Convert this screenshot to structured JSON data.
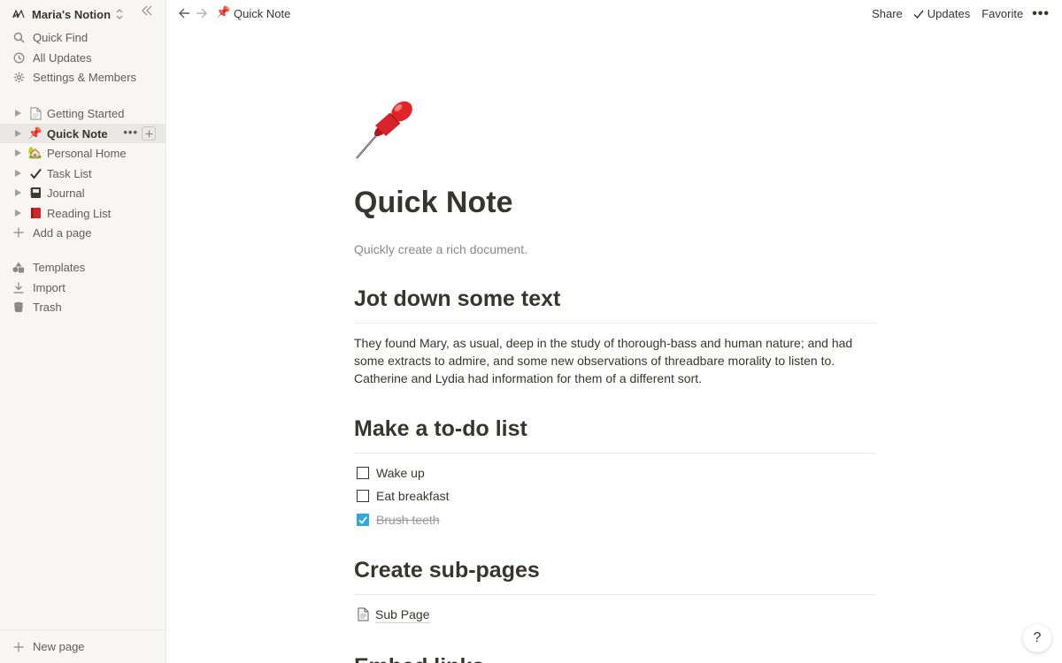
{
  "workspace": {
    "logo_text": "M",
    "name": "Maria's Notion"
  },
  "sidebar": {
    "top_items": [
      {
        "label": "Quick Find",
        "icon": "search-icon"
      },
      {
        "label": "All Updates",
        "icon": "clock-icon"
      },
      {
        "label": "Settings & Members",
        "icon": "gear-icon"
      }
    ],
    "pages": [
      {
        "label": "Getting Started",
        "emoji": "📄"
      },
      {
        "label": "Quick Note",
        "emoji": "📌",
        "active": true
      },
      {
        "label": "Personal Home",
        "emoji": "🏡"
      },
      {
        "label": "Task List",
        "emoji": "✔️"
      },
      {
        "label": "Journal",
        "emoji": "📓"
      },
      {
        "label": "Reading List",
        "emoji": "📕"
      }
    ],
    "add_page": "Add a page",
    "bottom_items": [
      {
        "label": "Templates",
        "icon": "templates-icon"
      },
      {
        "label": "Import",
        "icon": "import-icon"
      },
      {
        "label": "Trash",
        "icon": "trash-icon"
      }
    ],
    "new_page": "New page"
  },
  "topbar": {
    "breadcrumb_emoji": "📌",
    "breadcrumb": "Quick Note",
    "share": "Share",
    "updates": "Updates",
    "favorite": "Favorite",
    "more": "•••"
  },
  "document": {
    "title": "Quick Note",
    "subtitle": "Quickly create a rich document.",
    "section1_heading": "Jot down some text",
    "paragraph": "They found Mary, as usual, deep in the study of thorough-bass and human nature; and had some extracts to admire, and some new observations of threadbare morality to listen to. Catherine and Lydia had information for them of a different sort.",
    "section2_heading": "Make a to-do list",
    "todos": [
      {
        "text": "Wake up",
        "checked": false
      },
      {
        "text": "Eat breakfast",
        "checked": false
      },
      {
        "text": "Brush teeth",
        "checked": true
      }
    ],
    "section3_heading": "Create sub-pages",
    "sub_page": "Sub Page",
    "section4_heading": "Embed links"
  },
  "help": "?",
  "colors": {
    "accent": "#2eaadc",
    "pin_red": "#e0242a"
  }
}
